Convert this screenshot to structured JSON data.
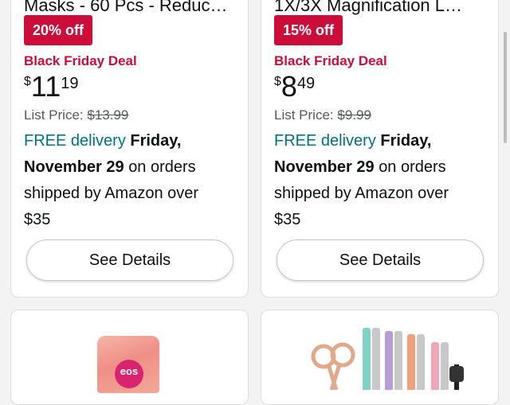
{
  "products": [
    {
      "title": "Masks - 60 Pcs - Reduc…",
      "discount_badge": "20% off",
      "deal_label": "Black Friday Deal",
      "price_symbol": "$",
      "price_whole": "11",
      "price_fraction": "19",
      "list_price_label": "List Price:",
      "list_price_value": "$13.99",
      "delivery_free": "FREE delivery",
      "delivery_date_1": "Friday,",
      "delivery_date_2": "November 29",
      "delivery_suffix_1": "on orders",
      "delivery_suffix_2": "shipped by Amazon over",
      "delivery_suffix_3": "$35",
      "button_label": "See Details"
    },
    {
      "title": "1X/3X Magnification L…",
      "discount_badge": "15% off",
      "deal_label": "Black Friday Deal",
      "price_symbol": "$",
      "price_whole": "8",
      "price_fraction": "49",
      "list_price_label": "List Price:",
      "list_price_value": "$9.99",
      "delivery_free": "FREE delivery",
      "delivery_date_1": "Friday,",
      "delivery_date_2": "November 29",
      "delivery_suffix_1": "on orders",
      "delivery_suffix_2": "shipped by Amazon over",
      "delivery_suffix_3": "$35",
      "button_label": "See Details"
    }
  ],
  "bottom_products": [
    {
      "image": "eos-shave-cream-bag",
      "logo_text": "eos"
    },
    {
      "image": "tweezers-scissors-set"
    }
  ],
  "colors": {
    "deal_red": "#cc0c39",
    "delivery_teal": "#007185",
    "background": "#f3f3f3"
  }
}
